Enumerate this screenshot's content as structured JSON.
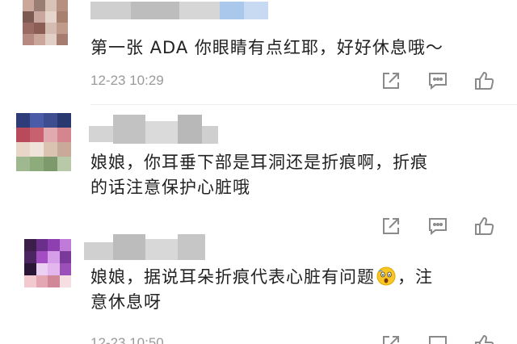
{
  "comments": [
    {
      "text": "第一张 ADA 你眼睛有点红耶，好好休息哦～",
      "timestamp": "12-23 10:29"
    },
    {
      "text": "娘娘，你耳垂下部是耳洞还是折痕啊，折痕\n的话注意保护心脏哦",
      "timestamp": ""
    },
    {
      "text_before_emoji": "娘娘，据说耳朵折痕代表心脏有问题",
      "emoji": "astonished-face",
      "text_after_emoji": "，注\n意休息呀",
      "timestamp": "12-23 10:50"
    }
  ],
  "actions": [
    "share-icon",
    "comment-icon",
    "like-icon"
  ],
  "colors": {
    "text": "#222222",
    "meta": "#9a9a9a",
    "icon": "#8a8a8a"
  }
}
